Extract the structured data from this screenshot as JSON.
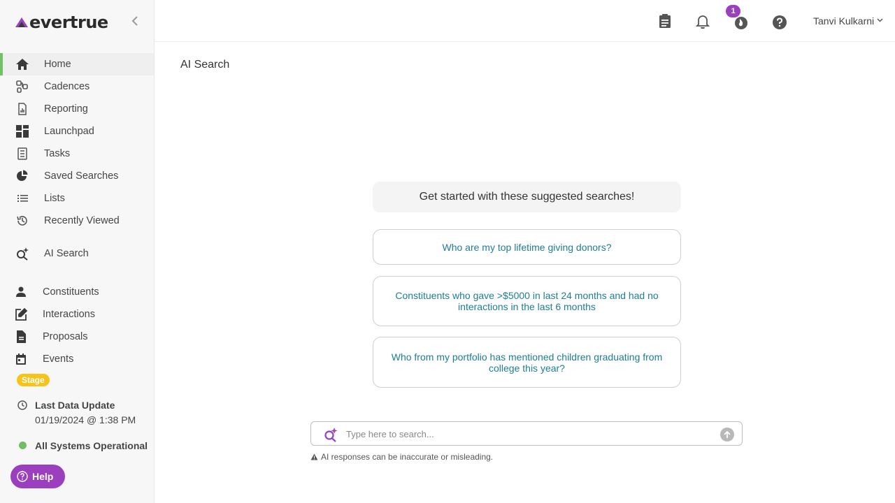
{
  "app": {
    "logo_text": "evertrue",
    "brand_color": "#9b3fbf",
    "accent_color": "#73c166"
  },
  "sidebar": {
    "primary": [
      {
        "label": "Home",
        "icon": "home-icon",
        "active": true
      },
      {
        "label": "Cadences",
        "icon": "cadences-icon"
      },
      {
        "label": "Reporting",
        "icon": "reporting-icon"
      },
      {
        "label": "Launchpad",
        "icon": "launchpad-icon"
      },
      {
        "label": "Tasks",
        "icon": "tasks-icon"
      },
      {
        "label": "Saved Searches",
        "icon": "pie-chart-icon"
      },
      {
        "label": "Lists",
        "icon": "list-icon"
      },
      {
        "label": "Recently Viewed",
        "icon": "history-icon"
      },
      {
        "label": "AI Search",
        "icon": "ai-search-icon"
      }
    ],
    "secondary": [
      {
        "label": "Constituents",
        "icon": "person-icon"
      },
      {
        "label": "Interactions",
        "icon": "edit-icon"
      },
      {
        "label": "Proposals",
        "icon": "document-icon"
      },
      {
        "label": "Events",
        "icon": "calendar-icon"
      }
    ],
    "stage_badge": "Stage",
    "last_update_label": "Last Data Update",
    "last_update_value": "01/19/2024 @ 1:38 PM",
    "status_label": "All Systems Operational",
    "help_label": "Help"
  },
  "topbar": {
    "notification_count": "1",
    "user_name": "Tanvi Kulkarni"
  },
  "main": {
    "page_title": "AI Search",
    "suggest_header": "Get started with these suggested searches!",
    "suggestions": [
      "Who are my top lifetime giving donors?",
      "Constituents who gave >$5000 in last 24 months and had no interactions in the last 6 months",
      "Who from my portfolio has mentioned children graduating from college this year?"
    ],
    "search_placeholder": "Type here to search...",
    "search_value": "",
    "disclaimer": "AI responses can be inaccurate or misleading."
  }
}
